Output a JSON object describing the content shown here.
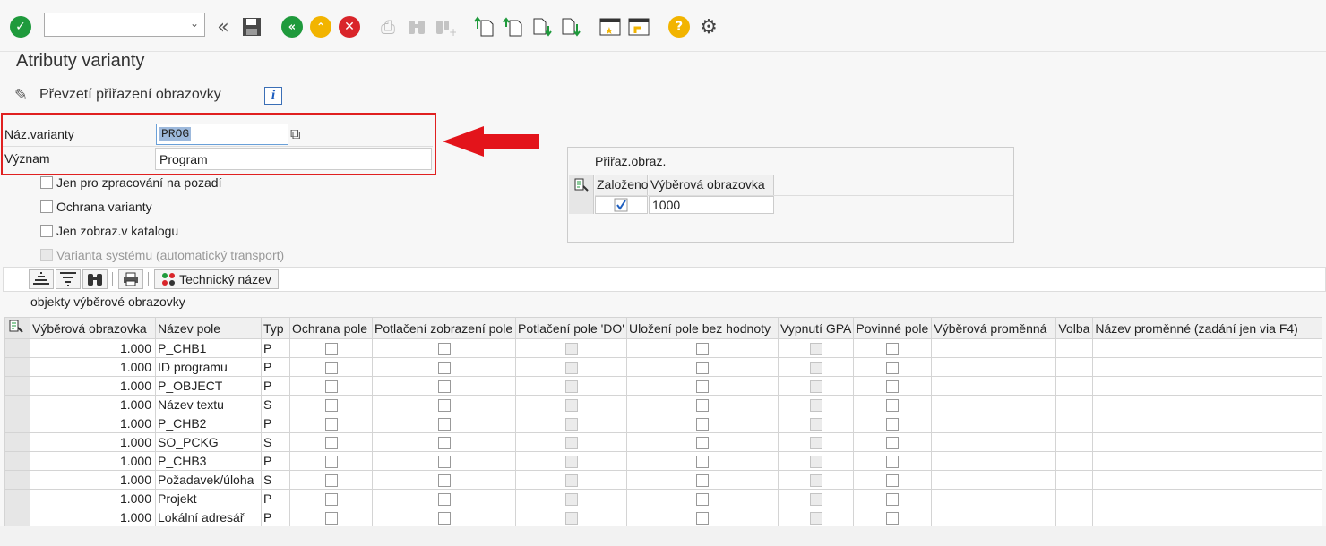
{
  "toolbar": {
    "command_value": "",
    "icons": [
      "enter-icon",
      "command-dropdown-icon",
      "collapse-icon",
      "save-icon",
      "back-icon",
      "exit-icon",
      "cancel-icon",
      "print-icon",
      "find-icon",
      "find-next-icon",
      "first-page-icon",
      "previous-page-icon",
      "next-page-icon",
      "last-page-icon",
      "create-session-icon",
      "shortcut-icon",
      "help-icon",
      "customize-layout-icon"
    ]
  },
  "page_title": "Atributy varianty",
  "subbar": {
    "label": "Převzetí přiřazení obrazovky",
    "info": "i"
  },
  "variant": {
    "name_label": "Náz.varianty",
    "name_value": "PROG",
    "meaning_label": "Význam",
    "meaning_value": "Program"
  },
  "checkboxes": [
    {
      "label": "Jen pro zpracování na pozadí",
      "checked": false,
      "disabled": false
    },
    {
      "label": "Ochrana varianty",
      "checked": false,
      "disabled": false
    },
    {
      "label": "Jen zobraz.v katalogu",
      "checked": false,
      "disabled": false
    },
    {
      "label": "Varianta systému (automatický transport)",
      "checked": false,
      "disabled": true
    }
  ],
  "screen_assign": {
    "title": "Přiřaz.obraz.",
    "col_created": "Založeno",
    "col_screen": "Výběrová obrazovka",
    "rows": [
      {
        "created": true,
        "screen": "1000"
      }
    ]
  },
  "grid_toolbar": {
    "technical_name": "Technický název"
  },
  "objects_label": "objekty výběrové obrazovky",
  "table": {
    "headers": [
      "Výběrová obrazovka",
      "Název pole",
      "Typ",
      "Ochrana pole",
      "Potlačení zobrazení pole",
      "Potlačení pole 'DO'",
      "Uložení pole bez hodnoty",
      "Vypnutí GPA",
      "Povinné pole",
      "Výběrová proměnná",
      "Volba",
      "Název proměnné (zadání jen via F4)"
    ],
    "rows": [
      {
        "screen": "1.000",
        "field": "P_CHB1",
        "type": "P"
      },
      {
        "screen": "1.000",
        "field": "ID programu",
        "type": "P"
      },
      {
        "screen": "1.000",
        "field": "P_OBJECT",
        "type": "P"
      },
      {
        "screen": "1.000",
        "field": "Název textu",
        "type": "S"
      },
      {
        "screen": "1.000",
        "field": "P_CHB2",
        "type": "P"
      },
      {
        "screen": "1.000",
        "field": "SO_PCKG",
        "type": "S"
      },
      {
        "screen": "1.000",
        "field": "P_CHB3",
        "type": "P"
      },
      {
        "screen": "1.000",
        "field": "Požadavek/úloha",
        "type": "S"
      },
      {
        "screen": "1.000",
        "field": "Projekt",
        "type": "P"
      },
      {
        "screen": "1.000",
        "field": "Lokální adresář",
        "type": "P"
      }
    ]
  },
  "colors": {
    "accent_red": "#e02020",
    "ok_green": "#1f9a3c",
    "yellow": "#f2b400",
    "cancel_red": "#d9252a",
    "selection": "#9db9dc"
  }
}
